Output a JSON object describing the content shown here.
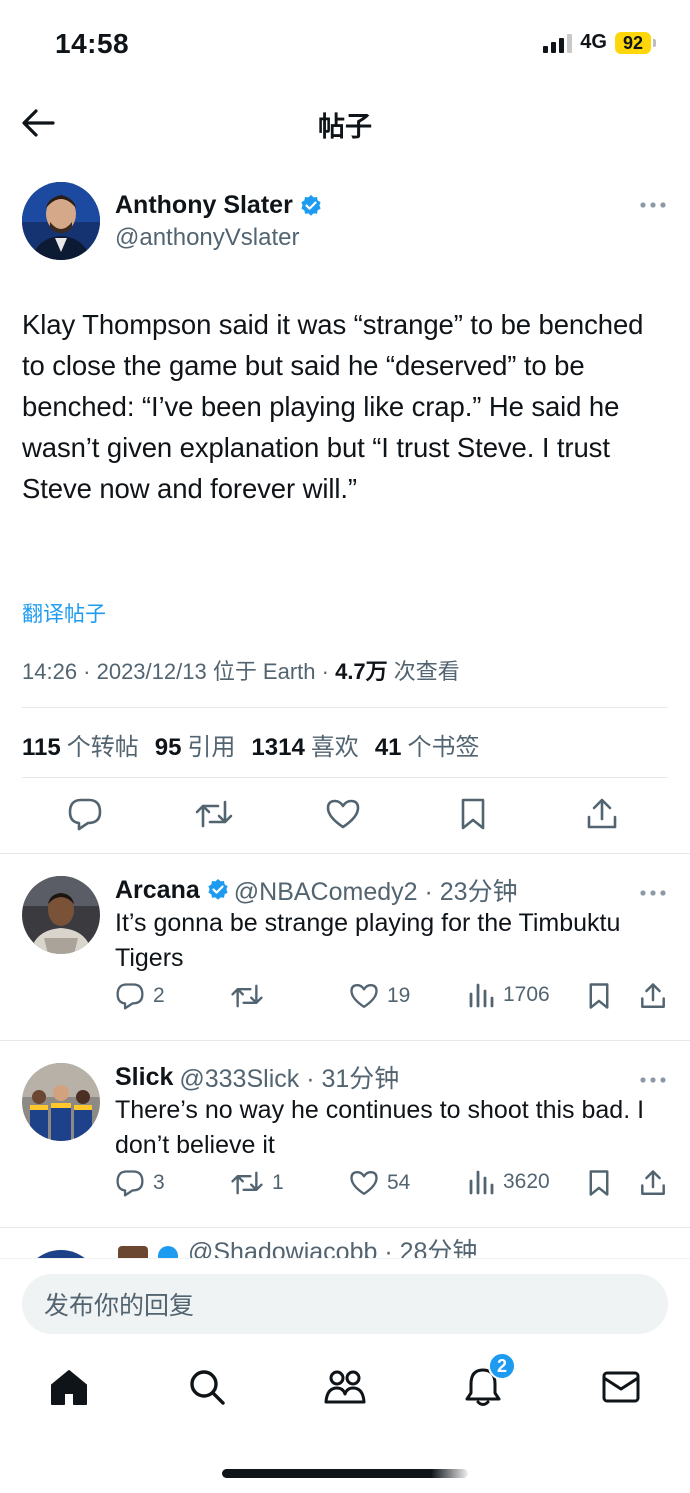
{
  "status": {
    "time": "14:58",
    "network": "4G",
    "battery": "92"
  },
  "nav": {
    "title": "帖子"
  },
  "post": {
    "author_name": "Anthony Slater",
    "author_handle": "@anthonyVslater",
    "text": "Klay Thompson said it was “strange” to be benched to close the game but said he “deserved” to be benched: “I’ve been playing like crap.” He said he wasn’t given explanation but “I trust Steve. I trust Steve now and forever will.”",
    "translate_label": "翻译帖子",
    "meta_time": "14:26 · 2023/12/13 位于 Earth · ",
    "meta_views": "4.7万",
    "meta_views_label": " 次查看",
    "stats": [
      {
        "count": "115",
        "label": "个转帖"
      },
      {
        "count": "95",
        "label": "引用"
      },
      {
        "count": "1314",
        "label": "喜欢"
      },
      {
        "count": "41",
        "label": "个书签"
      }
    ]
  },
  "replies": [
    {
      "name": "Arcana",
      "handle": "@NBAComedy2 · 23分钟",
      "text": "It’s gonna be strange playing for the Timbuktu Tigers",
      "replies": "2",
      "retweets": "",
      "likes": "19",
      "views": "1706"
    },
    {
      "name": "Slick",
      "handle": "@333Slick · 31分钟",
      "text": "There’s no way he continues to shoot this bad. I don’t believe it",
      "replies": "3",
      "retweets": "1",
      "likes": "54",
      "views": "3620"
    }
  ],
  "partial_reply": {
    "handle": "@Shadowjacobb · 28分钟"
  },
  "composer": {
    "placeholder": "发布你的回复"
  },
  "tabbar": {
    "notification_count": "2"
  },
  "colors": {
    "accent": "#1d9bf0",
    "verified": "#1d9bf0",
    "text": "#0f1419",
    "secondary": "#536471"
  },
  "icons": {
    "back": "arrow-left-icon",
    "more": "more-horizontal-icon",
    "verified": "verified-badge-icon",
    "reply": "comment-icon",
    "retweet": "retweet-icon",
    "like": "heart-icon",
    "bookmark": "bookmark-icon",
    "share": "share-icon",
    "views": "views-chart-icon",
    "home": "home-icon",
    "search": "search-icon",
    "communities": "communities-icon",
    "notifications": "bell-icon",
    "messages": "mail-icon"
  }
}
